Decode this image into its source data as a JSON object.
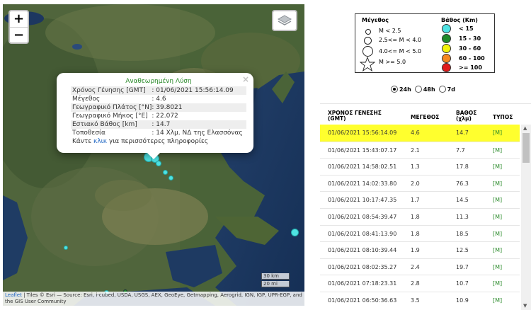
{
  "map": {
    "zoom_in_label": "+",
    "zoom_out_label": "−",
    "layers_icon": "layers-icon",
    "popup": {
      "title": "Αναθεωρημένη Λύση",
      "close_label": "×",
      "rows": [
        {
          "key": "Χρόνος Γένησης [GMT]",
          "value": ": 01/06/2021 15:56:14.09"
        },
        {
          "key": "Μέγεθος",
          "value": ": 4.6"
        },
        {
          "key": "Γεωγραφικό Πλάτος [°N]",
          "value": ": 39.8021"
        },
        {
          "key": "Γεωγραφικό Μήκος [°E]",
          "value": ": 22.072"
        },
        {
          "key": "Εστιακό Βάθος [km]",
          "value": ": 14.7"
        },
        {
          "key": "Τοποθεσία",
          "value": ": 14 Χλμ. ΝΔ της Ελασσόνας"
        }
      ],
      "more_prefix": "Κάντε",
      "more_link": "κλικ",
      "more_suffix": "για περισσότερες πληροφορίες"
    },
    "scale_km": "30 km",
    "scale_mi": "20 mi",
    "attribution_link": "Leaflet",
    "attribution_text": " | Tiles © Esri — Source: Esri, i-cubed, USDA, USGS, AEX, GeoEye, Getmapping, Aerogrid, IGN, IGP, UPR-EGP, and the GIS User Community"
  },
  "legend": {
    "magnitude_title": "Μέγεθος",
    "depth_title": "Βάθος (Km)",
    "magnitudes": [
      "M < 2.5",
      "2.5<= M < 4.0",
      "4.0<= M < 5.0",
      "M >= 5.0"
    ],
    "depths": [
      {
        "label": "< 15",
        "color": "#4fe3e3"
      },
      {
        "label": "15 - 30",
        "color": "#1f8a2a"
      },
      {
        "label": "30 - 60",
        "color": "#f2f20a"
      },
      {
        "label": "60 - 100",
        "color": "#f5871f"
      },
      {
        "label": ">= 100",
        "color": "#e01b1b"
      }
    ]
  },
  "time_filter": {
    "options": [
      "24h",
      "48h",
      "7d"
    ],
    "selected": "24h"
  },
  "table": {
    "headers": {
      "time": "ΧΡΟΝΟΣ ΓΕΝΕΣΗΣ",
      "time_sub": "(GMT)",
      "magnitude": "ΜΕΓΕΘΟΣ",
      "depth": "ΒΑΘΟΣ",
      "depth_sub": "(χλμ)",
      "type": "ΤΥΠΟΣ"
    },
    "rows": [
      {
        "time": "01/06/2021 15:56:14.09",
        "mag": "4.6",
        "depth": "14.7",
        "type": "[M]"
      },
      {
        "time": "01/06/2021 15:43:07.17",
        "mag": "2.1",
        "depth": "7.7",
        "type": "[M]"
      },
      {
        "time": "01/06/2021 14:58:02.51",
        "mag": "1.3",
        "depth": "17.8",
        "type": "[M]"
      },
      {
        "time": "01/06/2021 14:02:33.80",
        "mag": "2.0",
        "depth": "76.3",
        "type": "[M]"
      },
      {
        "time": "01/06/2021 10:17:47.35",
        "mag": "1.7",
        "depth": "14.5",
        "type": "[M]"
      },
      {
        "time": "01/06/2021 08:54:39.47",
        "mag": "1.8",
        "depth": "11.3",
        "type": "[M]"
      },
      {
        "time": "01/06/2021 08:41:13.90",
        "mag": "1.8",
        "depth": "18.5",
        "type": "[M]"
      },
      {
        "time": "01/06/2021 08:10:39.44",
        "mag": "1.9",
        "depth": "12.5",
        "type": "[M]"
      },
      {
        "time": "01/06/2021 08:02:35.27",
        "mag": "2.4",
        "depth": "19.7",
        "type": "[M]"
      },
      {
        "time": "01/06/2021 07:18:23.31",
        "mag": "2.8",
        "depth": "10.7",
        "type": "[M]"
      },
      {
        "time": "01/06/2021 06:50:36.63",
        "mag": "3.5",
        "depth": "10.9",
        "type": "[M]"
      }
    ],
    "highlight_color": "#ffff2e"
  }
}
